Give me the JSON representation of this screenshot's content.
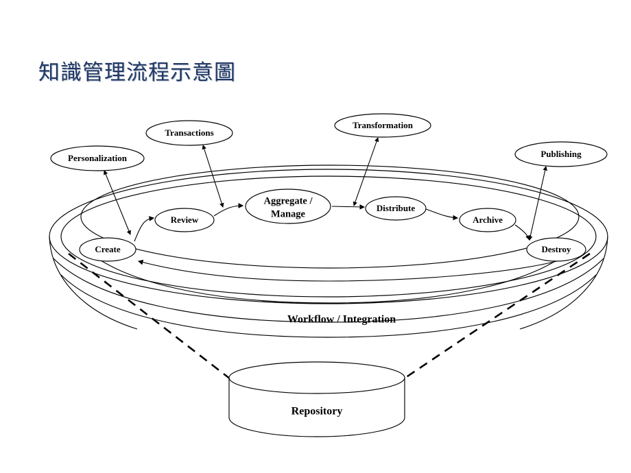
{
  "slide": {
    "title": "知識管理流程示意圖",
    "title_color": "#203864",
    "background_color": "#ffffff",
    "line_color": "#000000"
  },
  "diagram": {
    "type": "funnel-lifecycle-diagram",
    "band_label": "Workflow / Integration",
    "repository_label": "Repository",
    "cycle_nodes": [
      {
        "id": "create",
        "label": "Create"
      },
      {
        "id": "review",
        "label": "Review"
      },
      {
        "id": "aggregate",
        "label_line1": "Aggregate /",
        "label_line2": "Manage"
      },
      {
        "id": "distribute",
        "label": "Distribute"
      },
      {
        "id": "archive",
        "label": "Archive"
      },
      {
        "id": "destroy",
        "label": "Destroy"
      }
    ],
    "outer_nodes": [
      {
        "id": "personalization",
        "label": "Personalization",
        "connects_to": "create"
      },
      {
        "id": "transactions",
        "label": "Transactions",
        "connects_to": "review"
      },
      {
        "id": "transformation",
        "label": "Transformation",
        "connects_to": "distribute"
      },
      {
        "id": "publishing",
        "label": "Publishing",
        "connects_to": "destroy"
      }
    ]
  }
}
